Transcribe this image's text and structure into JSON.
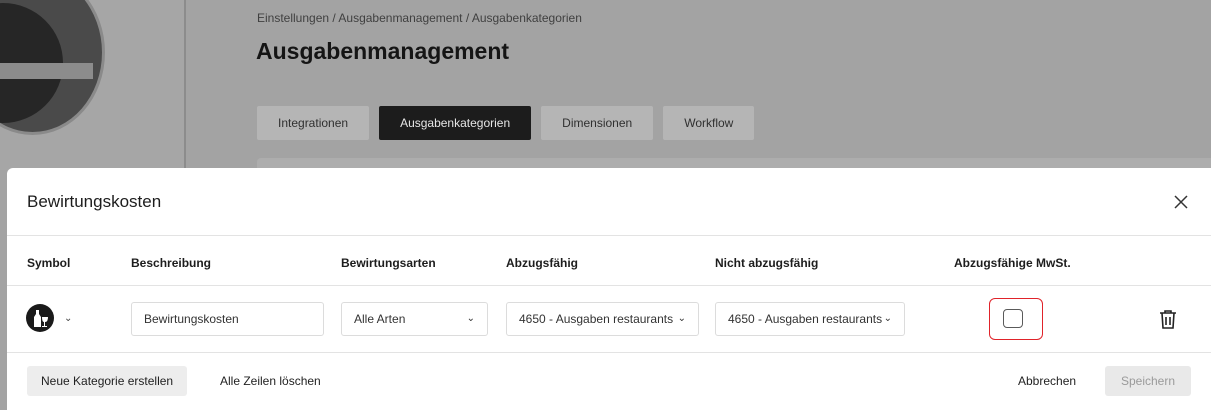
{
  "background": {
    "breadcrumb": "Einstellungen / Ausgabenmanagement / Ausgabenkategorien",
    "page_title": "Ausgabenmanagement",
    "tabs": [
      {
        "label": "Integrationen"
      },
      {
        "label": "Ausgabenkategorien",
        "active": true
      },
      {
        "label": "Dimensionen"
      },
      {
        "label": "Workflow"
      }
    ]
  },
  "modal": {
    "title": "Bewirtungskosten",
    "close_icon": "close-icon",
    "columns": {
      "symbol": "Symbol",
      "description": "Beschreibung",
      "types": "Bewirtungsarten",
      "deductible": "Abzugsfähig",
      "non_deductible": "Nicht abzugsfähig",
      "vat": "Abzugsfähige MwSt."
    },
    "row": {
      "symbol_icon": "wine-bottle-glass-icon",
      "description_value": "Bewirtungskosten",
      "types_value": "Alle Arten",
      "deductible_value": "4650 - Ausgaben restaurants",
      "non_deductible_value": "4650 - Ausgaben restaurants",
      "vat_checked": false,
      "delete_icon": "trash-icon"
    },
    "footer": {
      "new_category": "Neue Kategorie erstellen",
      "delete_all": "Alle Zeilen löschen",
      "cancel": "Abbrechen",
      "save": "Speichern"
    },
    "colors": {
      "highlight": "#e0232a",
      "active_tab": "#1c1c1c"
    }
  }
}
